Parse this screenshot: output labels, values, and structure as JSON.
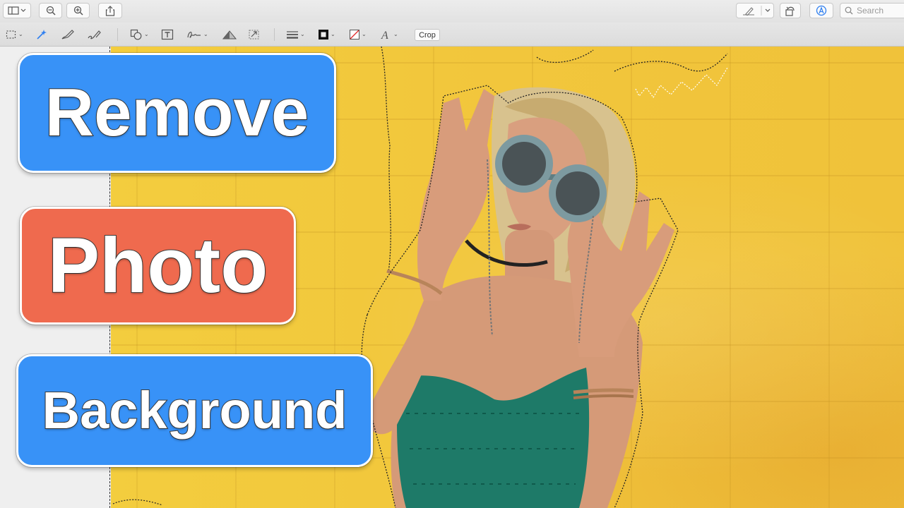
{
  "toolbar": {
    "search": {
      "placeholder": "Search",
      "icon": "magnifier-icon"
    },
    "crop_label": "Crop",
    "icons": {
      "sidebar": "sidebar-toggle-icon",
      "zoom_out": "zoom-out-icon",
      "zoom_in": "zoom-in-icon",
      "share": "share-icon",
      "pen": "markup-pen-icon",
      "rotate": "rotate-icon",
      "markup": "markup-toolbar-icon"
    }
  },
  "overlay": {
    "line1": {
      "text": "Remove",
      "color": "#3892f7"
    },
    "line2": {
      "text": "Photo",
      "color": "#ef6a4e"
    },
    "line3": {
      "text": "Background",
      "color": "#3892f7"
    }
  },
  "photo": {
    "background_color": "#f2c73c",
    "subject": "woman-holding-round-sunglasses",
    "top_color": "#1e7a68"
  }
}
